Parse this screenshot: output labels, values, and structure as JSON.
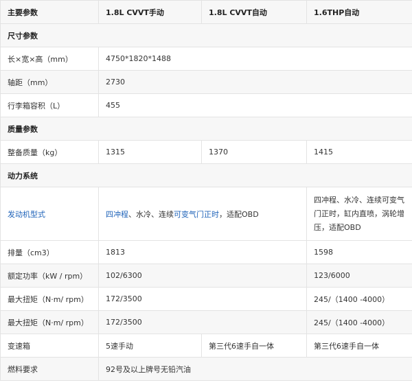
{
  "header": {
    "label": "主要参数",
    "col1": "1.8L CVVT手动",
    "col2": "1.8L CVVT自动",
    "col3": "1.6THP自动"
  },
  "sections": {
    "size": "尺寸参数",
    "mass": "质量参数",
    "power": "动力系统"
  },
  "size": {
    "dimensions": {
      "label": "长×宽×高（mm）",
      "value": "4750*1820*1488"
    },
    "wheelbase": {
      "label": "轴距（mm）",
      "value": "2730"
    },
    "trunk": {
      "label": "行李箱容积（L）",
      "value": "455"
    }
  },
  "mass": {
    "curb_weight": {
      "label": "整备质量（kg）",
      "v1": "1315",
      "v2": "1370",
      "v3": "1415"
    }
  },
  "power": {
    "engine": {
      "label": "发动机型式",
      "v12_prefix": "四冲程",
      "v12_mid": "、水冷、连续",
      "v12_link": "可变气门正时",
      "v12_suffix": "，适配OBD",
      "v3": "四冲程、水冷、连续可变气门正时，缸内直喷，涡轮增压，适配OBD"
    },
    "displacement": {
      "label": "排量（cm3）",
      "v12": "1813",
      "v3": "1598"
    },
    "rated_power": {
      "label": "额定功率（kW / rpm）",
      "v12": "102/6300",
      "v3": "123/6000"
    },
    "torque_1": {
      "label": "最大扭矩（N·m/ rpm）",
      "v12": "172/3500",
      "v3": "245/（1400 -4000）"
    },
    "torque_2": {
      "label": "最大扭矩（N·m/ rpm）",
      "v12": "172/3500",
      "v3": "245/（1400 -4000）"
    },
    "gearbox": {
      "label": "变速箱",
      "v1": "5速手动",
      "v2": "第三代6速手自一体",
      "v3": "第三代6速手自一体"
    },
    "fuel": {
      "label": "燃料要求",
      "value": "92号及以上牌号无铅汽油"
    }
  }
}
